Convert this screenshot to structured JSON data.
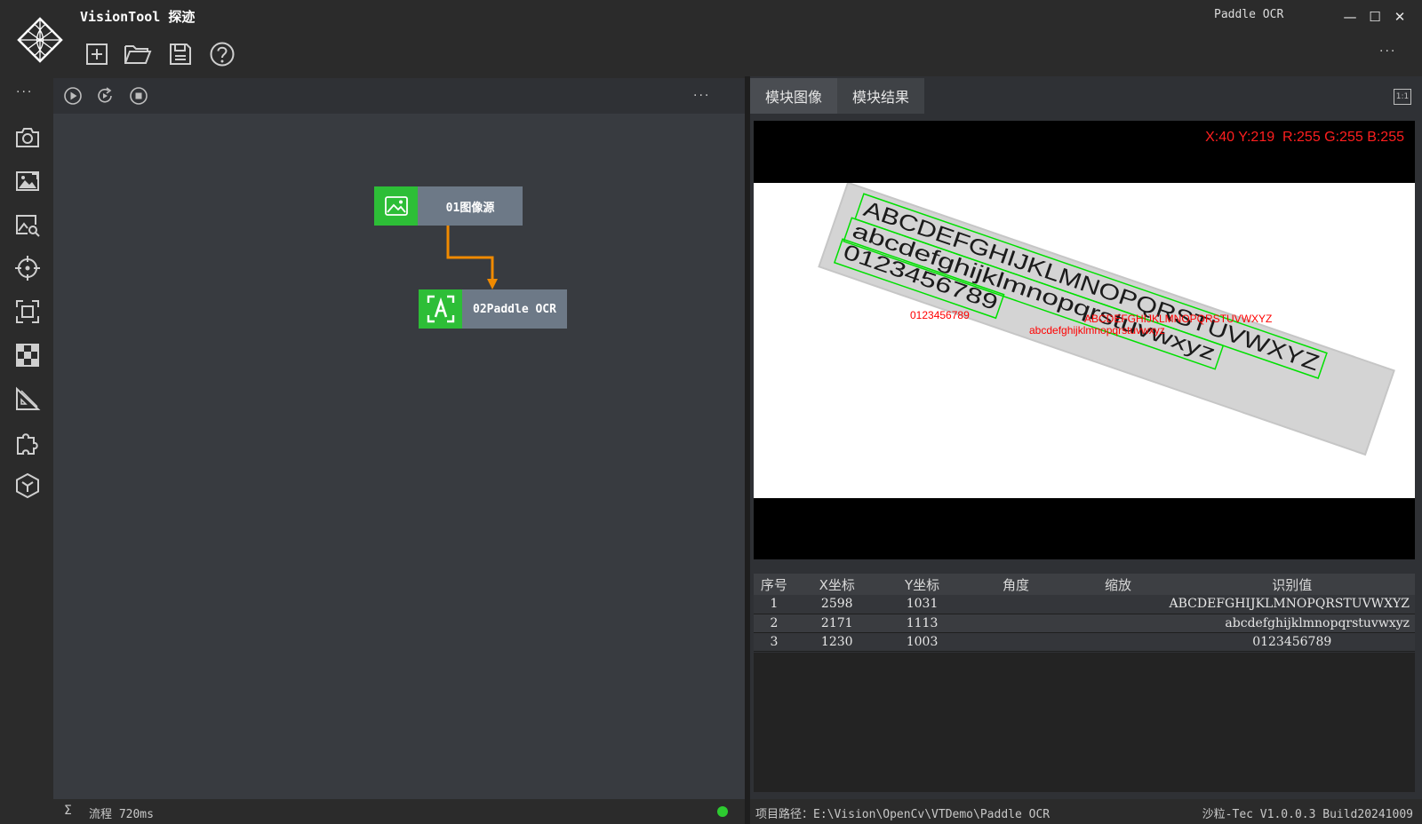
{
  "app": {
    "title": "VisionTool 探迹",
    "module_title": "Paddle OCR",
    "minimize": "—",
    "maximize": "☐",
    "close": "✕",
    "more": "···"
  },
  "toolbar": {
    "items": [
      "new-file-icon",
      "open-folder-icon",
      "save-icon",
      "help-icon"
    ]
  },
  "sidebar": {
    "more": "···",
    "icons": [
      "camera-icon",
      "image-edit-icon",
      "image-search-icon",
      "crosshair-icon",
      "focus-frame-icon",
      "checkerboard-icon",
      "ruler-triangle-icon",
      "puzzle-icon",
      "cube-icon"
    ]
  },
  "flow": {
    "controls": [
      "run-once-icon",
      "run-loop-icon",
      "stop-icon"
    ],
    "more": "···",
    "nodes": [
      {
        "label": "01图像源",
        "icon": "image-icon"
      },
      {
        "label": "02Paddle OCR",
        "icon": "text-recognition-icon"
      }
    ],
    "connector_color": "#f08a00",
    "status_sigma": "Σ",
    "status_text": "流程 720ms",
    "status_color": "#2dcb30"
  },
  "viewer": {
    "tabs": [
      "模块图像",
      "模块结果"
    ],
    "ratio_button": "1:1",
    "pixel_readout": "X:40 Y:219  R:255 G:255 B:255",
    "overlay_texts": [
      "ABCDEFGHIJKLMNOPQRSTUVWXYZ",
      "abcdefghijklmnopqrstuvwxyz",
      "0123456789"
    ],
    "label_lines": [
      "ABCDEFGHIJKLMNOPQRSTUVWXYZ",
      "abcdefghijklmnopqrstuvwxyz",
      "0123456789"
    ],
    "box_color": "#00e000",
    "text_color": "#ff0000"
  },
  "results": {
    "columns": [
      "序号",
      "X坐标",
      "Y坐标",
      "角度",
      "缩放",
      "识别值"
    ],
    "rows": [
      [
        "1",
        "2598",
        "1031",
        "",
        "",
        "ABCDEFGHIJKLMNOPQRSTUVWXYZ"
      ],
      [
        "2",
        "2171",
        "1113",
        "",
        "",
        "abcdefghijklmnopqrstuvwxyz"
      ],
      [
        "3",
        "1230",
        "1003",
        "",
        "",
        "0123456789"
      ]
    ]
  },
  "footer": {
    "project_path": "项目路径：E:\\Vision\\OpenCv\\VTDemo\\Paddle OCR",
    "version": "沙粒-Tec V1.0.0.3 Build20241009"
  }
}
